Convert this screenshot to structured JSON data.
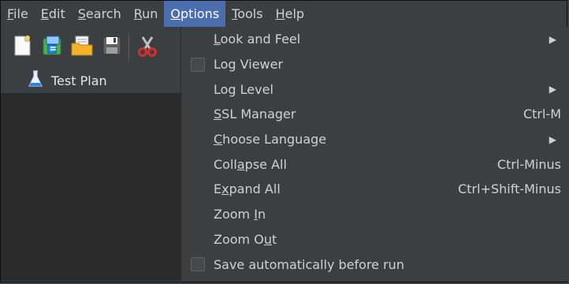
{
  "menubar": {
    "items": [
      {
        "pre": "",
        "mn": "F",
        "post": "ile"
      },
      {
        "pre": "",
        "mn": "E",
        "post": "dit"
      },
      {
        "pre": "",
        "mn": "S",
        "post": "earch"
      },
      {
        "pre": "",
        "mn": "R",
        "post": "un"
      },
      {
        "pre": "",
        "mn": "O",
        "post": "ptions"
      },
      {
        "pre": "",
        "mn": "T",
        "post": "ools"
      },
      {
        "pre": "",
        "mn": "H",
        "post": "elp"
      }
    ],
    "active_index": 4
  },
  "toolbar": {
    "icons": [
      "new-icon",
      "templates-icon",
      "open-icon",
      "save-icon",
      "cut-icon"
    ]
  },
  "tree": {
    "root": {
      "label": "Test Plan",
      "icon": "flask-icon"
    }
  },
  "options_menu": {
    "items": [
      {
        "pre": "",
        "mn": "L",
        "post": "ook and Feel",
        "shortcut": "",
        "submenu": true,
        "checkbox": false
      },
      {
        "pre": "Log Viewer",
        "mn": "",
        "post": "",
        "shortcut": "",
        "submenu": false,
        "checkbox": true
      },
      {
        "pre": "Log Level",
        "mn": "",
        "post": "",
        "shortcut": "",
        "submenu": true,
        "checkbox": false
      },
      {
        "pre": "",
        "mn": "S",
        "post": "SL Manager",
        "shortcut": "Ctrl-M",
        "submenu": false,
        "checkbox": false
      },
      {
        "pre": "",
        "mn": "C",
        "post": "hoose Language",
        "shortcut": "",
        "submenu": true,
        "checkbox": false
      },
      {
        "pre": "Coll",
        "mn": "a",
        "post": "pse All",
        "shortcut": "Ctrl-Minus",
        "submenu": false,
        "checkbox": false
      },
      {
        "pre": "E",
        "mn": "x",
        "post": "pand All",
        "shortcut": "Ctrl+Shift-Minus",
        "submenu": false,
        "checkbox": false
      },
      {
        "pre": "Zoom ",
        "mn": "I",
        "post": "n",
        "shortcut": "",
        "submenu": false,
        "checkbox": false
      },
      {
        "pre": "Zoom O",
        "mn": "u",
        "post": "t",
        "shortcut": "",
        "submenu": false,
        "checkbox": false
      },
      {
        "pre": "Save automatically before run",
        "mn": "",
        "post": "",
        "shortcut": "",
        "submenu": false,
        "checkbox": true
      }
    ]
  },
  "colors": {
    "background": "#3c3f41",
    "tree_background": "#2b2b2b",
    "active_menu": "#4b6eaf",
    "text": "#cfd2d4"
  }
}
